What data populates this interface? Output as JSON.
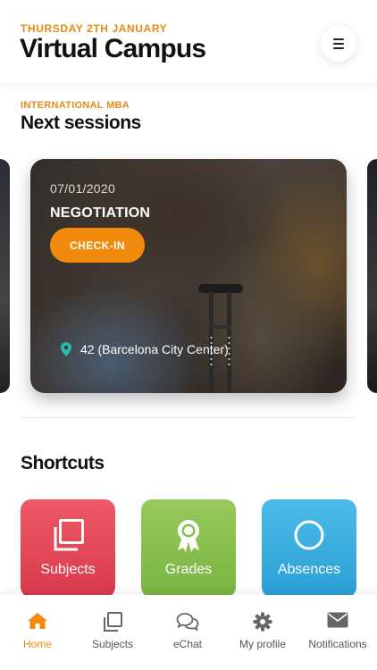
{
  "header": {
    "date": "THURSDAY 2TH JANUARY",
    "title": "Virtual Campus",
    "menu_icon": "hamburger-icon"
  },
  "program": {
    "label": "INTERNATIONAL MBA",
    "section_title": "Next sessions"
  },
  "session_card": {
    "date": "07/01/2020",
    "title": "NEGOTIATION",
    "checkin_label": "CHECK-IN",
    "location": "42 (Barcelona City Center)",
    "location_icon": "map-pin-icon"
  },
  "shortcuts": {
    "title": "Shortcuts",
    "items": [
      {
        "label": "Subjects",
        "icon": "copy-icon",
        "color": "#e24a5a"
      },
      {
        "label": "Grades",
        "icon": "award-icon",
        "color": "#86bf4c"
      },
      {
        "label": "Absences",
        "icon": "circle-icon",
        "color": "#38aee0"
      }
    ]
  },
  "tabbar": {
    "active_color": "#f28b0c",
    "items": [
      {
        "label": "Home",
        "icon": "home-icon",
        "active": true
      },
      {
        "label": "Subjects",
        "icon": "copy-icon",
        "active": false
      },
      {
        "label": "eChat",
        "icon": "chat-icon",
        "active": false
      },
      {
        "label": "My profile",
        "icon": "gear-icon",
        "active": false
      },
      {
        "label": "Notifications",
        "icon": "envelope-icon",
        "active": false
      }
    ]
  },
  "colors": {
    "accent": "#e98a15",
    "button": "#f28b0c"
  }
}
